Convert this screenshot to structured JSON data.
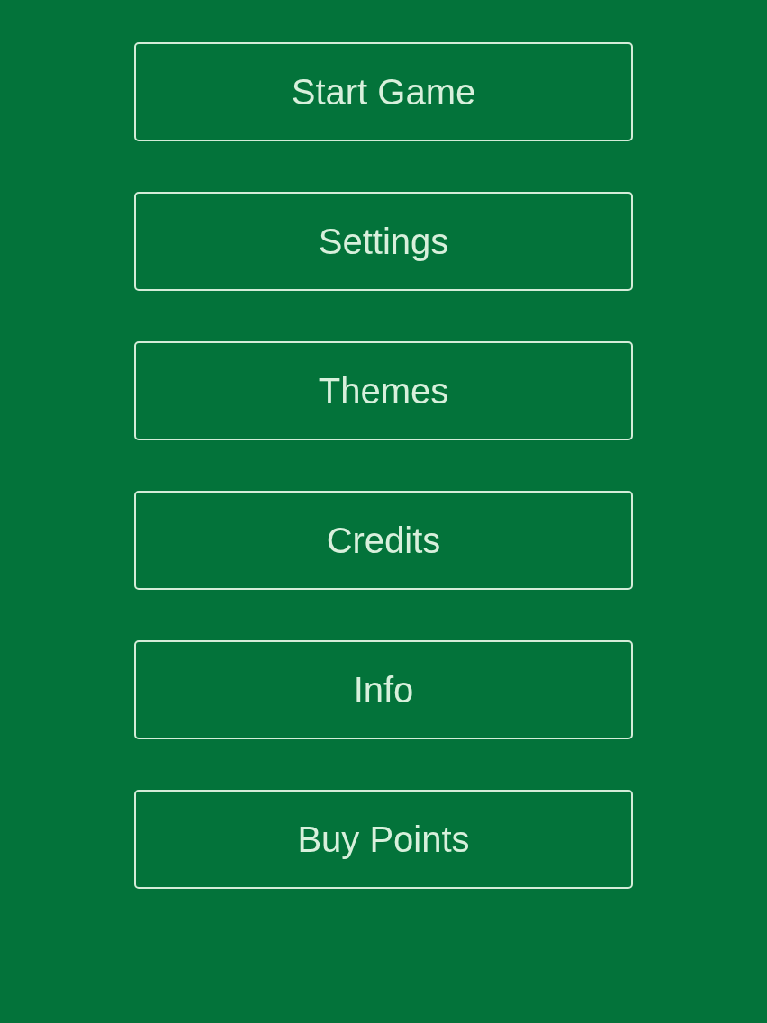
{
  "menu": {
    "buttons": [
      {
        "label": "Start Game"
      },
      {
        "label": "Settings"
      },
      {
        "label": "Themes"
      },
      {
        "label": "Credits"
      },
      {
        "label": "Info"
      },
      {
        "label": "Buy Points"
      }
    ]
  }
}
